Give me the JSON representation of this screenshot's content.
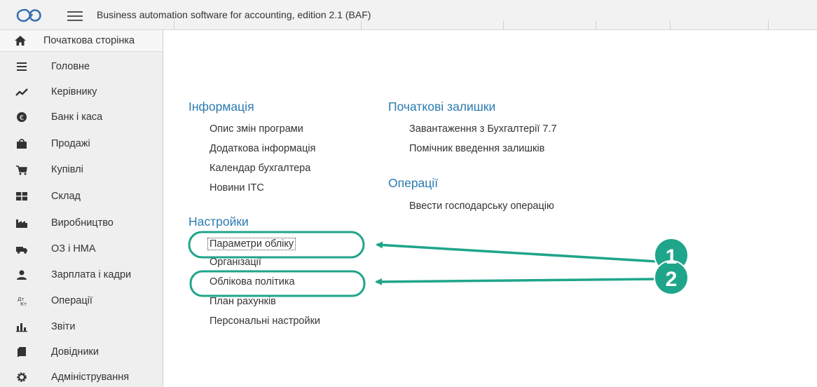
{
  "app": {
    "title": "Business automation software for accounting, edition 2.1  (BAF)"
  },
  "sidebar": {
    "home_label": "Початкова сторінка",
    "items": [
      {
        "label": "Головне",
        "icon": "menu-lines-icon"
      },
      {
        "label": "Керівнику",
        "icon": "trend-icon"
      },
      {
        "label": "Банк і каса",
        "icon": "coin-icon"
      },
      {
        "label": "Продажі",
        "icon": "bag-icon"
      },
      {
        "label": "Купівлі",
        "icon": "cart-icon"
      },
      {
        "label": "Склад",
        "icon": "warehouse-icon"
      },
      {
        "label": "Виробництво",
        "icon": "factory-icon"
      },
      {
        "label": "ОЗ і НМА",
        "icon": "truck-icon"
      },
      {
        "label": "Зарплата і кадри",
        "icon": "person-icon"
      },
      {
        "label": "Операції",
        "icon": "dt-kt-icon"
      },
      {
        "label": "Звіти",
        "icon": "bar-chart-icon"
      },
      {
        "label": "Довідники",
        "icon": "book-icon"
      },
      {
        "label": "Адміністрування",
        "icon": "gear-icon"
      }
    ]
  },
  "main": {
    "info": {
      "title": "Інформація",
      "links": [
        "Опис змін програми",
        "Додаткова інформація",
        "Календар бухгалтера",
        "Новини ІТС"
      ]
    },
    "settings": {
      "title": "Настройки",
      "links": [
        "Параметри обліку",
        "Організації",
        "Облікова політика",
        "План рахунків",
        "Персональні настройки"
      ]
    },
    "opening": {
      "title": "Початкові залишки",
      "links": [
        "Завантаження з Бухгалтерії 7.7",
        "Помічник введення залишків"
      ]
    },
    "operations": {
      "title": "Операції",
      "links": [
        "Ввести господарську операцію"
      ]
    }
  },
  "annotations": {
    "badge1": "1",
    "badge2": "2",
    "color": "#1fa58a"
  }
}
